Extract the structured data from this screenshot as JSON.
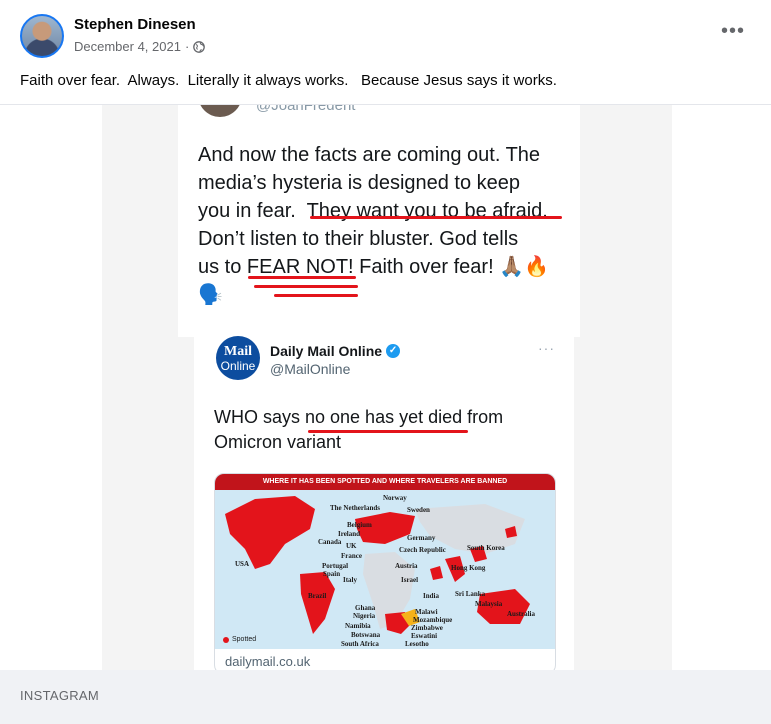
{
  "post": {
    "author": "Stephen Dinesen",
    "date": "December 4, 2021",
    "separator": "·",
    "privacy_icon": "globe-icon",
    "more_icon": "more-options-icon",
    "text": "Faith over fear.  Always.  Literally it always works.   Because Jesus says it works."
  },
  "tweet": {
    "handle_cut": "@JoanFredent",
    "lines": [
      "And now the facts are coming out. The",
      "media’s hysteria is designed to keep",
      "you in fear.  They want you to be afraid.",
      "Don’t listen to their bluster. God tells",
      "us to FEAR NOT! Faith over fear! 🙏🏽🔥",
      "🗣️"
    ]
  },
  "quoted_tweet": {
    "logo_line1": "Mail",
    "logo_line2": "Online",
    "name": "Daily Mail Online",
    "verified_icon": "verified-badge-icon",
    "handle": "@MailOnline",
    "more": "···",
    "text_lines": [
      "WHO says no one has yet died from",
      "Omicron variant"
    ],
    "map": {
      "banner": "WHERE IT HAS BEEN SPOTTED AND WHERE TRAVELERS ARE BANNED",
      "labels": [
        "Norway",
        "The Netherlands",
        "Sweden",
        "Belgium",
        "Ireland",
        "Germany",
        "UK",
        "Canada",
        "France",
        "Czech Republic",
        "South Korea",
        "USA",
        "Portugal",
        "Spain",
        "Austria",
        "Hong Kong",
        "Italy",
        "Israel",
        "Brazil",
        "India",
        "Sri Lanka",
        "Malaysia",
        "Ghana",
        "Nigeria",
        "Malawi",
        "Mozambique",
        "Australia",
        "Namibia",
        "Zimbabwe",
        "Botswana",
        "Eswatini",
        "South Africa",
        "Lesotho"
      ],
      "legend": "Spotted"
    },
    "link_domain": "dailymail.co.uk"
  },
  "footer": {
    "source": "INSTAGRAM"
  },
  "colors": {
    "accent": "#1877f2",
    "underline": "#e3141b",
    "banner": "#c1141b"
  }
}
